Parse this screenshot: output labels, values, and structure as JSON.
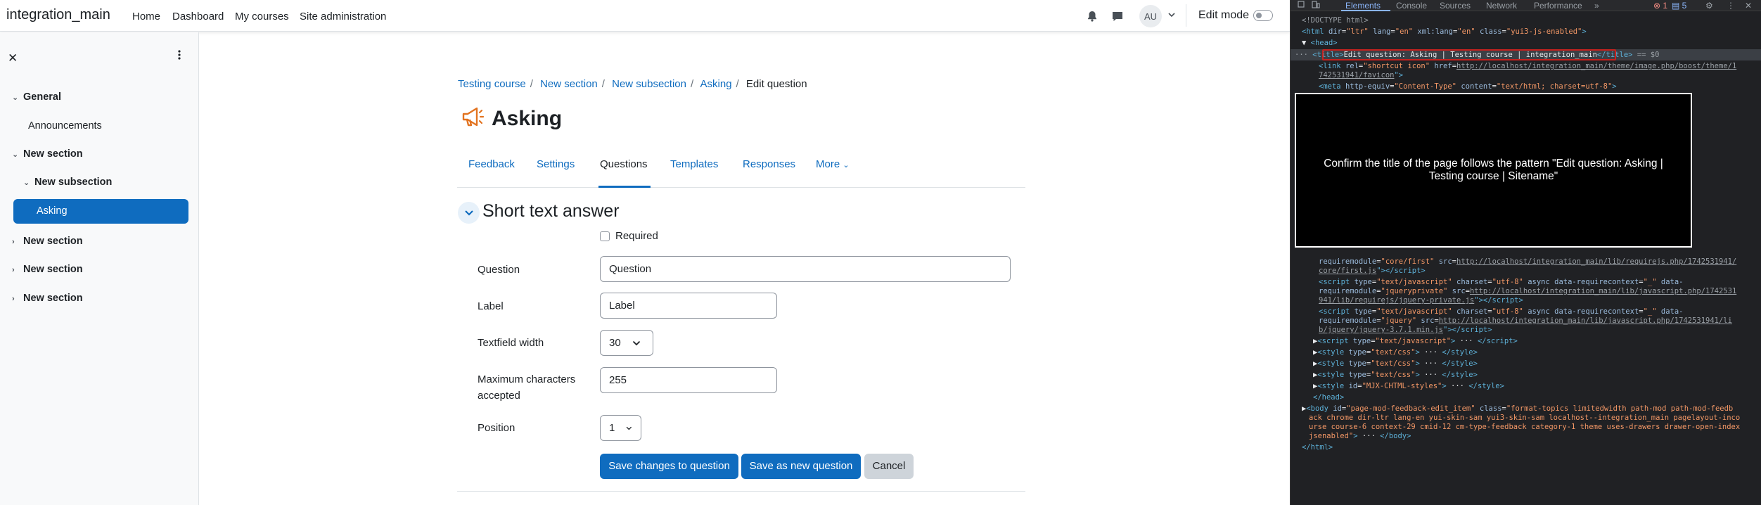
{
  "navbar": {
    "site_name": "integration_main",
    "links": [
      "Home",
      "Dashboard",
      "My courses",
      "Site administration"
    ],
    "user_initials": "AU",
    "edit_mode_label": "Edit mode"
  },
  "course_index": {
    "items": [
      {
        "label": "General",
        "type": "section"
      },
      {
        "label": "Announcements",
        "type": "activity"
      },
      {
        "label": "New section",
        "type": "section"
      },
      {
        "label": "New subsection",
        "type": "subsection"
      },
      {
        "label": "Asking",
        "type": "activity",
        "active": true
      },
      {
        "label": "New section",
        "type": "section"
      },
      {
        "label": "New section",
        "type": "section"
      },
      {
        "label": "New section",
        "type": "section"
      }
    ]
  },
  "breadcrumb": {
    "items": [
      "Testing course",
      "New section",
      "New subsection",
      "Asking"
    ],
    "current": "Edit question"
  },
  "page": {
    "title": "Asking",
    "tabs": [
      "Feedback",
      "Settings",
      "Questions",
      "Templates",
      "Responses",
      "More"
    ],
    "active_tab": "Questions"
  },
  "form": {
    "section_title": "Short text answer",
    "required_label": "Required",
    "required_checked": false,
    "question_label": "Question",
    "question_value": "Question",
    "label_label": "Label",
    "label_value": "Label",
    "textfield_width_label": "Textfield width",
    "textfield_width_value": "30",
    "max_chars_label": "Maximum characters accepted",
    "max_chars_value": "255",
    "position_label": "Position",
    "position_value": "1",
    "save_button": "Save changes to question",
    "save_new_button": "Save as new question",
    "cancel_button": "Cancel"
  },
  "devtools": {
    "tabs": [
      "Elements",
      "Console",
      "Sources",
      "Network",
      "Performance"
    ],
    "active_tab": "Elements",
    "error_count": "1",
    "message_count": "5",
    "title_tag_content": "Edit question: Asking | Testing course | integration_main",
    "favicon_url_1": "http://localhost/integration_main/theme/image.php/boost/theme/1",
    "favicon_url_2": "742531941/favicon",
    "requirejs_url": "http://localhost/integration_main/lib/requirejs.php/1742531941/",
    "requirejs_url_2": "core/first.js",
    "jquerypriv_url": "http://localhost/integration_main/lib/javascript.php/1742531",
    "jquerypriv_url_2": "941/lib/requirejs/jquery-private.js",
    "jquery_url": "http://localhost/integration_main/lib/javascript.php/1742531941/li",
    "jquery_url_2": "b/jquery/jquery-3.7.1.min.js",
    "body_class_1": "format-topics limitedwidth  path-mod path-mod-feedb",
    "body_class_2": "ack chrome dir-ltr lang-en yui-skin-sam yui3-skin-sam localhost--integration_main pagelayout-inco",
    "body_class_3": "urse course-6 context-29 cmid-12 cm-type-feedback category-1 theme uses-drawers drawer-open-index",
    "body_class_4": "jsenabled"
  },
  "overlay": {
    "text": "Confirm the title of the page follows the pattern \"Edit question: Asking | Testing course | Sitename\""
  }
}
